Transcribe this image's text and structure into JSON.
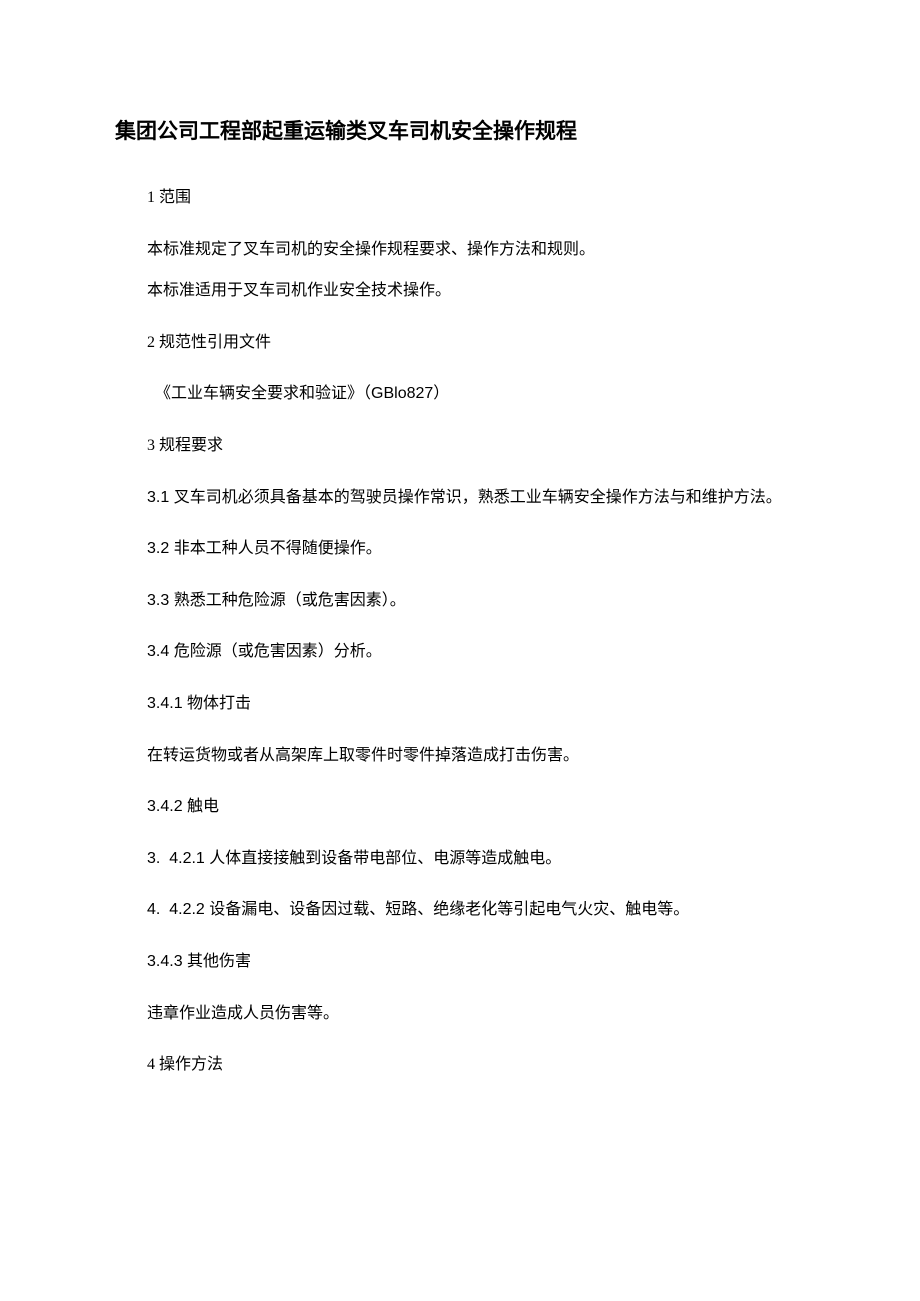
{
  "title": "集团公司工程部起重运输类叉车司机安全操作规程",
  "paragraphs": {
    "p1": "1 范围",
    "p2": "本标准规定了叉车司机的安全操作规程要求、操作方法和规则。",
    "p3": "本标准适用于叉车司机作业安全技术操作。",
    "p4_a": "2 规范性引用文件",
    "p5_a": "《工业车辆安全要求和验证》（",
    "p5_b": "GBlo827",
    "p5_c": "）",
    "p6": "3 规程要求",
    "p7_a": "3.1 ",
    "p7_b": "叉车司机必须具备基本的驾驶员操作常识，熟悉工业车辆安全操作方法与和维护方法。",
    "p8_a": "3.2 ",
    "p8_b": "非本工种人员不得随便操作。",
    "p9_a": "3.3 ",
    "p9_b": "熟悉工种危险源（或危害因素）。",
    "p10_a": "3.4 ",
    "p10_b": "危险源（或危害因素）分析。",
    "p11_a": "3.4.1 ",
    "p11_b": "物体打击",
    "p12": "在转运货物或者从高架库上取零件时零件掉落造成打击伤害。",
    "p13_a": "3.4.2 ",
    "p13_b": "触电",
    "p14_a": "3.  4.2.1 ",
    "p14_b": "人体直接接触到设备带电部位、电源等造成触电。",
    "p15_a": "4.  4.2.2 ",
    "p15_b": "设备漏电、设备因过载、短路、绝缘老化等引起电气火灾、触电等。",
    "p16_a": "3.4.3 ",
    "p16_b": "其他伤害",
    "p17": "违章作业造成人员伤害等。",
    "p18": "4 操作方法"
  }
}
